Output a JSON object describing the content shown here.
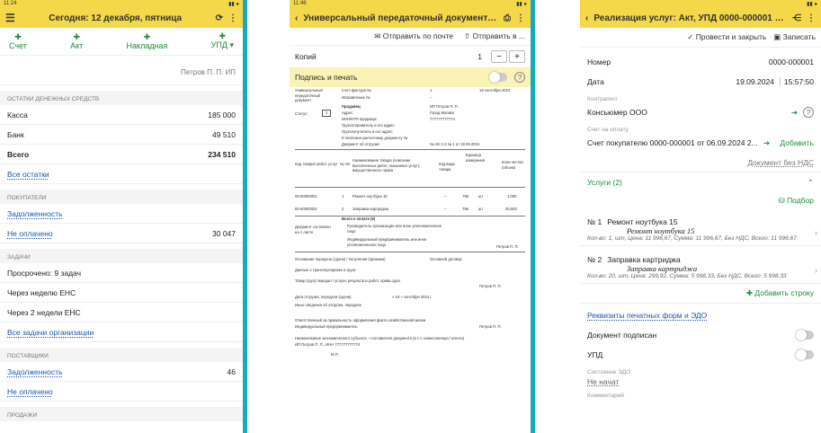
{
  "p1": {
    "status_time": "11:24",
    "title": "Сегодня: 12 декабря, пятница",
    "actions": [
      {
        "label": "Счет",
        "icon": "plus-icon"
      },
      {
        "label": "Акт",
        "icon": "plus-icon"
      },
      {
        "label": "Накладная",
        "icon": "plus-icon"
      },
      {
        "label": "УПД ▾",
        "icon": "plus-icon"
      }
    ],
    "user": "Петров П. П. ИП",
    "cash_section": "ОСТАТКИ ДЕНЕЖНЫХ СРЕДСТВ",
    "cash": [
      {
        "label": "Касса",
        "value": "185 000"
      },
      {
        "label": "Банк",
        "value": "49 510"
      },
      {
        "label": "Всего",
        "value": "234 510"
      }
    ],
    "all_balances": "Все остатки",
    "buyers_section": "ПОКУПАТЕЛИ",
    "debts": "Задолженность",
    "unpaid": "Не оплачено",
    "unpaid_value": "30 047",
    "tasks_section": "ЗАДАЧИ",
    "tasks": [
      "Просрочено: 9 задач",
      "Через неделю ЕНС",
      "Через 2 недели ЕНС"
    ],
    "all_tasks": "Все задачи организации",
    "suppliers_section": "ПОСТАВЩИКИ",
    "sup_debts": "Задолженность",
    "sup_debts_value": "46",
    "sup_unpaid": "Не оплачено",
    "sales_section": "ПРОДАЖИ"
  },
  "p2": {
    "status_time": "11:46",
    "title": "Универсальный передаточный документ №0000-...",
    "send_mail": "Отправить по почте",
    "send": "Отправить в ...",
    "copies_label": "Копий",
    "copies_value": "1",
    "sign_label": "Подпись и печать",
    "doc": {
      "upd_title": "Универсальный передаточный документ",
      "invoice": "Счет-фактура №",
      "invoice_no": "1",
      "invoice_date": "19 сентября 2024",
      "fix": "Исправление №",
      "fix_val": "--",
      "seller_lbl": "Продавец:",
      "seller": "ИП Петров П. П.",
      "addr_lbl": "Адрес:",
      "addr": "Город Москва",
      "inn_lbl": "ИНН/КПП продавца:",
      "inn": "777777777774",
      "status_lbl": "Статус:",
      "status": "2",
      "shipper": "Грузоотправитель и его адрес:",
      "consignee": "Грузополучатель и его адрес:",
      "paydoc": "К платежно-расчетному документу №",
      "shipdoc": "Документ об отгрузке",
      "shipdoc_val": "№ п/п 1-2 № 1 от 19.09.2024",
      "col_code": "Код товара/ работ, услуг",
      "col_no": "№ п/п",
      "col_name": "Наименование товара (описание выполненных работ, оказанных услуг), имущественного права",
      "col_kind": "Код вида товара",
      "col_unit": "Единица измерения",
      "col_qty": "Коли-чество (объем)",
      "rows": [
        {
          "code": "00-00000001",
          "no": "1",
          "name": "Ремонт ноутбука 15",
          "kind": "--",
          "unit": "796",
          "u": "шт",
          "qty": "1,000"
        },
        {
          "code": "00-00000002",
          "no": "2",
          "name": "Заправка картриджа",
          "kind": "--",
          "unit": "796",
          "u": "шт",
          "qty": "20,000"
        }
      ],
      "total": "Всего к оплате (9)",
      "composed": "Документ составлен на 1 листе",
      "head": "Руководитель организации или иное уполномоченное лицо",
      "ip": "Индивидуальный предприниматель или иное уполномоченное лицо",
      "signer": "Петров П. П.",
      "basis": "Основание передачи (сдачи) / получения (приемки)",
      "basis_val": "Основной договор",
      "transport": "Данные о транспортировке и грузе",
      "goods": "Товар (груз) передал / услуги, результаты работ, права сдал",
      "goods_signer": "Петров П. П.",
      "ship_date": "Дата отгрузки, передачи (сдачи)",
      "ship_date_val": "« 19 » сентября 2024 г.",
      "other": "Иные сведения об отгрузке, передаче",
      "resp": "Ответственный за правильность оформления факта хозяйственной жизни",
      "resp_ip": "Индивидуальный предприниматель",
      "resp_signer": "Петров П. П.",
      "entity": "Наименование экономического субъекта – составителя документа (в т.ч. комиссионера / агента)",
      "entity_val": "ИП Петров П. П., ИНН 777777777774",
      "mp": "М.П."
    }
  },
  "p3": {
    "title": "Реализация услуг: Акт, УПД 0000-000001 от 19.0...",
    "post_close": "Провести и закрыть",
    "save": "Записать",
    "number_label": "Номер",
    "number": "0000-000001",
    "date_label": "Дата",
    "date": "19.09.2024",
    "time": "15:57:50",
    "counterparty_label": "Контрагент",
    "counterparty": "Консьюмер ООО",
    "invoice_label": "Счет на оплату",
    "invoice": "Счет покупателю 0000-000001 от 06.09.2024 2...",
    "add": "Добавить",
    "no_vat": "Документ без НДС",
    "services": "Услуги (2)",
    "selection": "Подбор",
    "items": [
      {
        "no": "№ 1",
        "name": "Ремонт ноутбука 15",
        "print": "Ремонт ноутбука 15",
        "details": "Кол-во: 1, шт, Цена: 11 996,67, Сумма: 11 996,67, Без НДС, Всего: 11 996,67"
      },
      {
        "no": "№ 2",
        "name": "Заправка картриджа",
        "print": "Заправка картриджа",
        "details": "Кол-во: 20, шт, Цена: 299,92, Сумма: 5 998,33, Без НДС, Всего: 5 998,33"
      }
    ],
    "add_row": "Добавить строку",
    "print_forms": "Реквизиты печатных форм и ЭДО",
    "signed_label": "Документ подписан",
    "upd_label": "УПД",
    "edo_label": "Состояние ЭДО",
    "edo_value": "Не начат",
    "comment_label": "Комментарий"
  },
  "colors": {
    "header": "#f4d84a",
    "separator": "#1aa8bf",
    "green": "#1f8a3b",
    "link": "#1f56a8"
  }
}
